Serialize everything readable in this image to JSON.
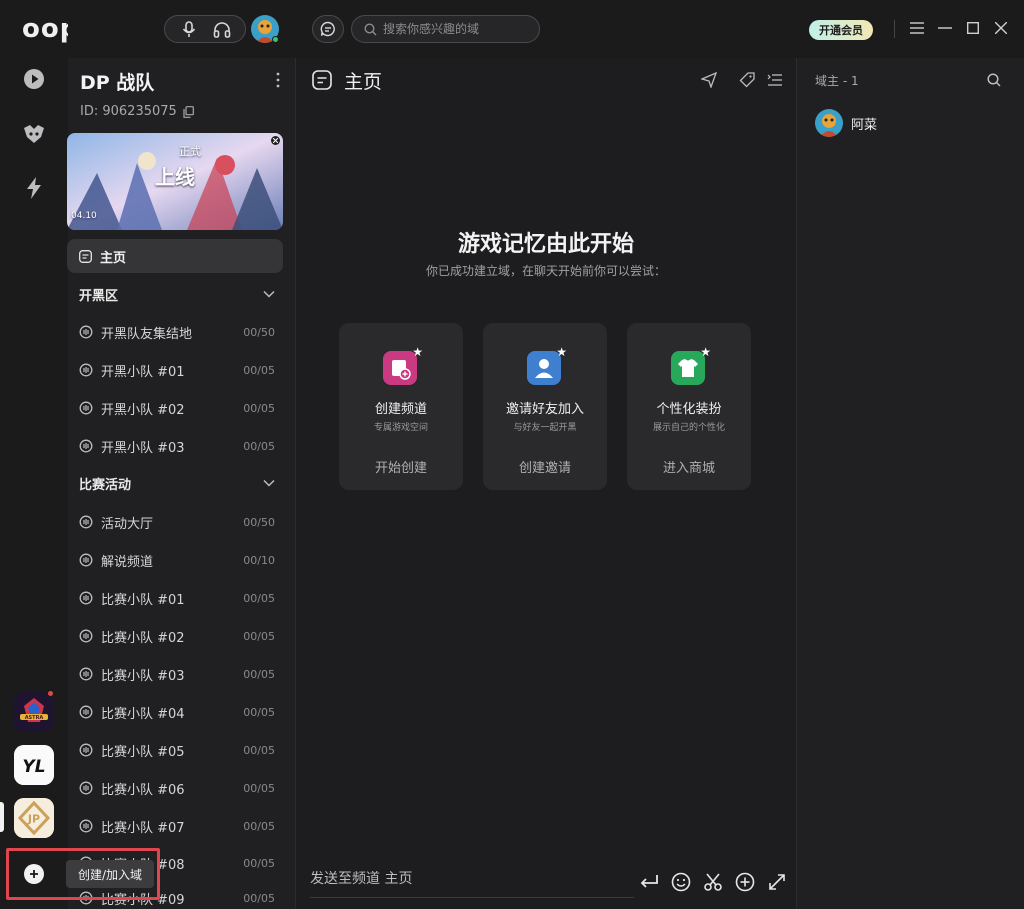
{
  "app": {
    "logo_text": "oopz."
  },
  "topbar": {
    "search_placeholder": "搜索你感兴趣的域",
    "vip_label": "开通会员",
    "icons": [
      "microphone-icon",
      "headphones-icon",
      "chat-bubble-icon",
      "search-icon",
      "menu-icon",
      "minimize-icon",
      "maximize-icon",
      "close-icon"
    ]
  },
  "server": {
    "name": "DP 战队",
    "id_text": "ID: 906235075",
    "banner_text": {
      "big": "上线",
      "small": "正式",
      "date": "04.10"
    },
    "home_label": "主页",
    "categories": [
      {
        "name": "开黑区",
        "channels": [
          {
            "name": "开黑队友集结地",
            "count": "00/50"
          },
          {
            "name": "开黑小队 #01",
            "count": "00/05"
          },
          {
            "name": "开黑小队 #02",
            "count": "00/05"
          },
          {
            "name": "开黑小队 #03",
            "count": "00/05"
          }
        ]
      },
      {
        "name": "比赛活动",
        "channels": [
          {
            "name": "活动大厅",
            "count": "00/50"
          },
          {
            "name": "解说频道",
            "count": "00/10"
          },
          {
            "name": "比赛小队 #01",
            "count": "00/05"
          },
          {
            "name": "比赛小队 #02",
            "count": "00/05"
          },
          {
            "name": "比赛小队 #03",
            "count": "00/05"
          },
          {
            "name": "比赛小队 #04",
            "count": "00/05"
          },
          {
            "name": "比赛小队 #05",
            "count": "00/05"
          },
          {
            "name": "比赛小队 #06",
            "count": "00/05"
          },
          {
            "name": "比赛小队 #07",
            "count": "00/05"
          },
          {
            "name": "比赛小队 #08",
            "count": "00/05"
          },
          {
            "name": "比赛小队 #09",
            "count": "00/05"
          }
        ]
      }
    ]
  },
  "rail": {
    "server_labels": [
      "ASTRA",
      "YL",
      "JP"
    ],
    "create_tooltip": "创建/加入域"
  },
  "main": {
    "title": "主页",
    "hero_title": "游戏记忆由此开始",
    "hero_subtitle": "你已成功建立域，在聊天开始前你可以尝试：",
    "cards": [
      {
        "title": "创建频道",
        "subtitle": "专属游戏空间",
        "action": "开始创建",
        "color": "#c93a82",
        "icon": "channel-add-icon"
      },
      {
        "title": "邀请好友加入",
        "subtitle": "与好友一起开黑",
        "action": "创建邀请",
        "color": "#3f7fd0",
        "icon": "user-invite-icon"
      },
      {
        "title": "个性化装扮",
        "subtitle": "展示自己的个性化",
        "action": "进入商城",
        "color": "#27a85a",
        "icon": "tshirt-icon"
      }
    ],
    "composer_placeholder": "发送至频道 主页"
  },
  "members": {
    "section_title": "域主 - 1",
    "list": [
      {
        "name": "阿菜"
      }
    ]
  },
  "colors": {
    "bg": "#1b1b1c",
    "panel": "#202022",
    "accent_red": "#e0464e"
  }
}
